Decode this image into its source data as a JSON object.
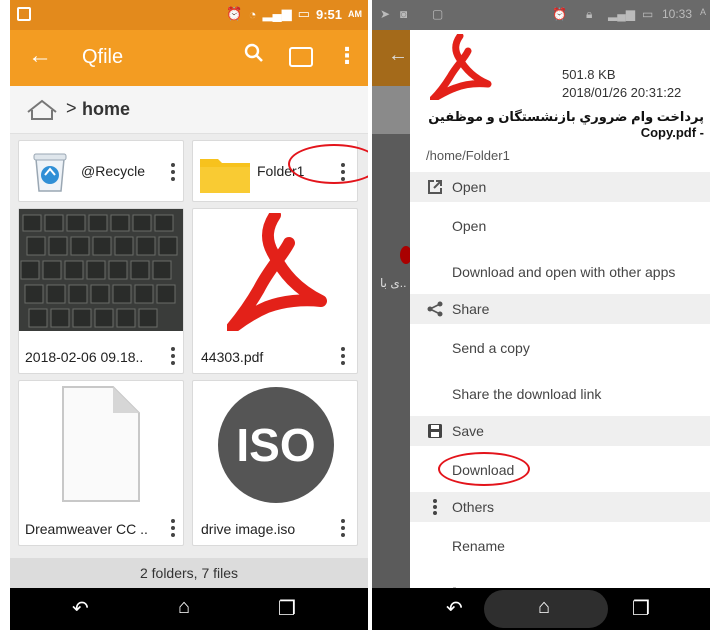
{
  "left": {
    "status_time": "9:51",
    "status_ampm": "AM",
    "app_title": "Qfile",
    "breadcrumb": "home",
    "items": [
      {
        "name": "@Recycle"
      },
      {
        "name": "Folder1"
      },
      {
        "name": "2018-02-06 09.18.."
      },
      {
        "name": "44303.pdf"
      },
      {
        "name": "Dreamweaver CC .."
      },
      {
        "name": "drive image.iso"
      }
    ],
    "iso_label": "ISO",
    "footer": "2 folders, 7 files"
  },
  "right": {
    "status_time": "10:33",
    "status_ampm": "A",
    "behind_text": "ی با..",
    "file_size": "501.8 KB",
    "file_date": "2018/01/26 20:31:22",
    "file_name": "پرداخت وام ضروري بازنشستگان و موظفين - Copy.pdf",
    "path": "/home/Folder1",
    "sections": [
      {
        "title": "Open",
        "options": [
          "Open",
          "Download and open with other apps"
        ]
      },
      {
        "title": "Share",
        "options": [
          "Send a copy",
          "Share the download link"
        ]
      },
      {
        "title": "Save",
        "options": [
          "Download"
        ]
      },
      {
        "title": "Others",
        "options": [
          "Rename"
        ]
      }
    ]
  },
  "colors": {
    "accent": "#f39c22",
    "status_bar": "#e38a1c",
    "highlight_ring": "#e3141b",
    "pdf_red": "#e32119"
  }
}
